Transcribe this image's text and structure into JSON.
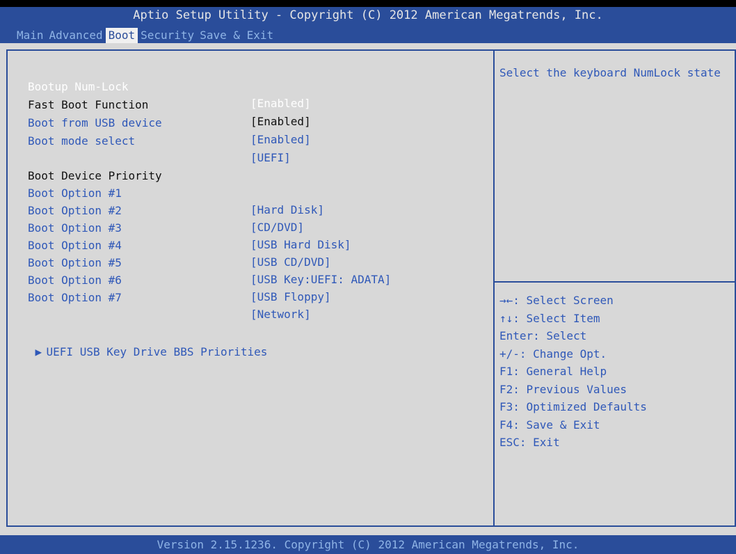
{
  "header": {
    "title": "Aptio Setup Utility - Copyright (C) 2012 American Megatrends, Inc.",
    "tabs": [
      "Main",
      "Advanced",
      "Boot",
      "Security",
      "Save & Exit"
    ],
    "active_tab": "Boot"
  },
  "settings": [
    {
      "label": "Bootup Num-Lock",
      "value": "[Enabled]"
    },
    {
      "label": "Fast Boot Function",
      "value": "[Enabled]"
    },
    {
      "label": "Boot from USB device",
      "value": "[Enabled]"
    },
    {
      "label": "Boot mode select",
      "value": "[UEFI]"
    }
  ],
  "priority_heading": "Boot Device Priority",
  "boot_options": [
    {
      "label": "Boot Option #1",
      "value": "[Hard Disk]"
    },
    {
      "label": "Boot Option #2",
      "value": "[CD/DVD]"
    },
    {
      "label": "Boot Option #3",
      "value": "[USB Hard Disk]"
    },
    {
      "label": "Boot Option #4",
      "value": "[USB CD/DVD]"
    },
    {
      "label": "Boot Option #5",
      "value": "[USB Key:UEFI: ADATA]"
    },
    {
      "label": "Boot Option #6",
      "value": "[USB Floppy]"
    },
    {
      "label": "Boot Option #7",
      "value": "[Network]"
    }
  ],
  "submenu": {
    "label": "UEFI USB Key Drive BBS Priorities",
    "arrow_icon": "right-triangle-icon"
  },
  "help": {
    "text": "Select the keyboard NumLock state",
    "keys": [
      "→←: Select Screen",
      "↑↓: Select Item",
      "Enter: Select",
      "+/-: Change Opt.",
      "F1: General Help",
      "F2: Previous Values",
      "F3: Optimized Defaults",
      "F4: Save & Exit",
      "ESC: Exit"
    ]
  },
  "footer": "Version 2.15.1236. Copyright (C) 2012 American Megatrends, Inc.",
  "colors": {
    "bar_blue": "#2a4d9a",
    "panel_gray": "#d8d8d8",
    "text_blue": "#2f58b8",
    "tab_text": "#8fb4e6",
    "selected_white": "#ffffff"
  }
}
